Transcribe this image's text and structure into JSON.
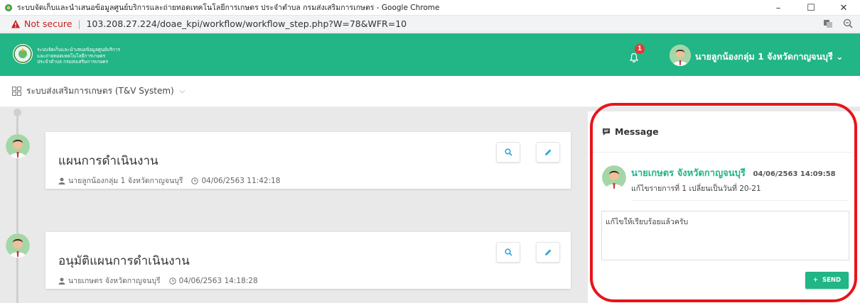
{
  "window": {
    "title": "ระบบจัดเก็บและนำเสนอข้อมูลศูนย์บริการและถ่ายทอดเทคโนโลยีการเกษตร ประจำตำบล กรมส่งเสริมการเกษตร - Google Chrome",
    "controls": [
      "–",
      "☐",
      "✕"
    ]
  },
  "address": {
    "security_label": "Not secure",
    "url": "103.208.27.224/doae_kpi/workflow/workflow_step.php?W=78&WFR=10"
  },
  "appbar": {
    "brand_lines": [
      "ระบบจัดเก็บและนำเสนอข้อมูลศูนย์บริการ",
      "และถ่ายทอดเทคโนโลยีการเกษตร",
      "ประจำตำบล กรมส่งเสริมการเกษตร"
    ],
    "notification_count": "1",
    "user_name": "นายลูกน้องกลุ่ม 1 จังหวัดกาญจนบุรี"
  },
  "subnav": {
    "system_label": "ระบบส่งเสริมการเกษตร (T&V System)"
  },
  "workflow": {
    "steps": [
      {
        "title": "แผนการดำเนินงาน",
        "author": "นายลูกน้องกลุ่ม 1 จังหวัดกาญจนบุรี",
        "timestamp": "04/06/2563 11:42:18"
      },
      {
        "title": "อนุมัติแผนการดำเนินงาน",
        "author": "นายเกษตร จังหวัดกาญจนบุรี",
        "timestamp": "04/06/2563 14:18:28"
      }
    ]
  },
  "message_panel": {
    "heading": "Message",
    "message": {
      "author": "นายเกษตร จังหวัดกาญจนบุรี",
      "timestamp": "04/06/2563 14:09:58",
      "text": "แก้ไขรายการที่ 1 เปลี่ยนเป็นวันที่ 20-21"
    },
    "reply_value": "แก้ไขให้เรียบร้อยแล้วครับ",
    "send_label": "SEND"
  },
  "colors": {
    "brand_green": "#22b585",
    "alert_red": "#e8141b"
  }
}
